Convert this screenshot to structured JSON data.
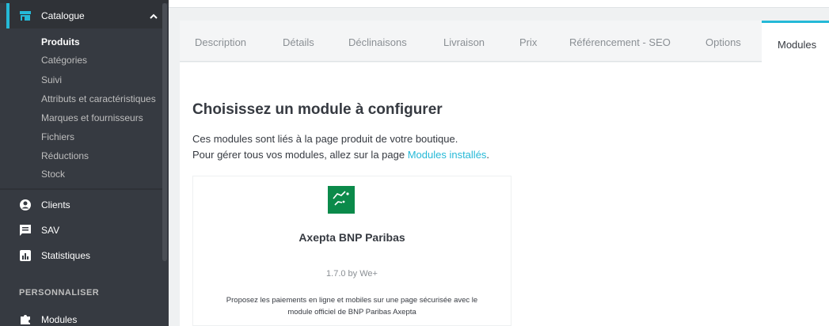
{
  "sidebar": {
    "catalogue": {
      "label": "Catalogue"
    },
    "sub_items": [
      {
        "label": "Produits"
      },
      {
        "label": "Catégories"
      },
      {
        "label": "Suivi"
      },
      {
        "label": "Attributs et caractéristiques"
      },
      {
        "label": "Marques et fournisseurs"
      },
      {
        "label": "Fichiers"
      },
      {
        "label": "Réductions"
      },
      {
        "label": "Stock"
      }
    ],
    "clients": {
      "label": "Clients"
    },
    "sav": {
      "label": "SAV"
    },
    "statistiques": {
      "label": "Statistiques"
    },
    "section_title": "PERSONNALISER",
    "modules": {
      "label": "Modules"
    }
  },
  "tabs": [
    {
      "label": "Description"
    },
    {
      "label": "Détails"
    },
    {
      "label": "Déclinaisons"
    },
    {
      "label": "Livraison"
    },
    {
      "label": "Prix"
    },
    {
      "label": "Référencement - SEO"
    },
    {
      "label": "Options"
    },
    {
      "label": "Modules"
    }
  ],
  "main": {
    "title": "Choisissez un module à configurer",
    "line1": "Ces modules sont liés à la page produit de votre boutique.",
    "line2_prefix": "Pour gérer tous vos modules, allez sur la page ",
    "line2_link": "Modules installés",
    "line2_suffix": "."
  },
  "module_card": {
    "name": "Axepta BNP Paribas",
    "version": "1.7.0 by We+",
    "description_line1": "Proposez les paiements en ligne et mobiles sur une page sécurisée avec le",
    "description_line2": "module officiel de BNP Paribas Axepta"
  },
  "colors": {
    "sidebar_bg": "#363a41",
    "accent": "#25b9d7",
    "logo_green": "#0b8a4a"
  }
}
